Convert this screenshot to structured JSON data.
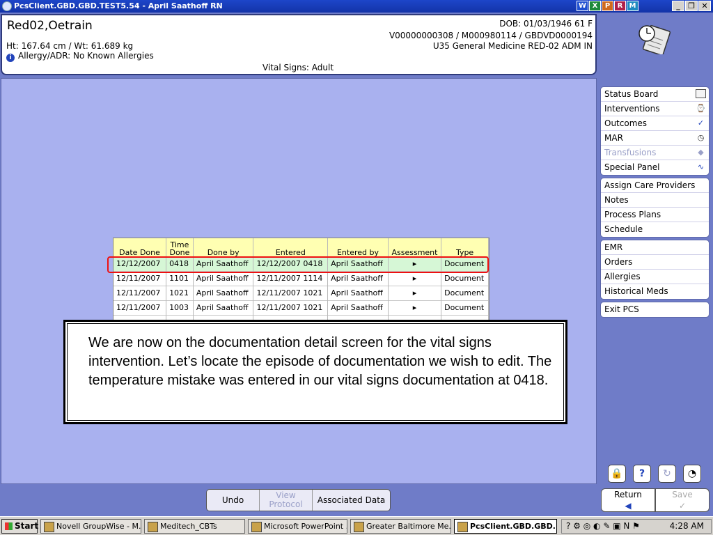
{
  "window": {
    "title": "PcsClient.GBD.GBD.TEST5.54 - April Saathoff RN",
    "app_buttons": [
      "W",
      "X",
      "P",
      "R",
      "M"
    ]
  },
  "patient": {
    "name": "Red02,Oetrain",
    "ht_wt": "Ht: 167.64 cm / Wt: 61.689 kg",
    "allergy": "Allergy/ADR: No Known Allergies",
    "dob": "DOB: 01/03/1946 61 F",
    "account": "V00000000308 / M000980114 / GBDVD0000194",
    "location": "U35 General Medicine  RED-02  ADM IN",
    "screen_title": "Vital Signs: Adult"
  },
  "grid": {
    "columns": [
      "Date Done",
      "Time Done",
      "Done by",
      "Entered",
      "Entered by",
      "Assessment",
      "Type"
    ],
    "rows": [
      [
        "12/12/2007",
        "0418",
        "April Saathoff",
        "12/12/2007 0418",
        "April Saathoff",
        "▸",
        "Document"
      ],
      [
        "12/11/2007",
        "1101",
        "April Saathoff",
        "12/11/2007 1114",
        "April Saathoff",
        "▸",
        "Document"
      ],
      [
        "12/11/2007",
        "1021",
        "April Saathoff",
        "12/11/2007 1021",
        "April Saathoff",
        "▸",
        "Document"
      ],
      [
        "12/11/2007",
        "1003",
        "April Saathoff",
        "12/11/2007 1021",
        "April Saathoff",
        "▸",
        "Document"
      ],
      [
        "",
        "",
        "",
        "",
        "",
        "",
        ""
      ]
    ]
  },
  "callout": {
    "text": "We are now on the documentation detail screen for the vital signs intervention. Let’s locate the episode of documentation we wish to edit. The temperature mistake was entered in our vital signs documentation at 0418."
  },
  "actions": {
    "undo": "Undo",
    "view_protocol": "View Protocol",
    "associated_data": "Associated Data"
  },
  "menu": {
    "group1": [
      {
        "label": "Status Board",
        "icon": "book-icon"
      },
      {
        "label": "Interventions",
        "icon": "interventions-icon"
      },
      {
        "label": "Outcomes",
        "icon": "outcomes-icon"
      },
      {
        "label": "MAR",
        "icon": "mar-icon"
      },
      {
        "label": "Transfusions",
        "icon": "transfusions-icon"
      },
      {
        "label": "Special Panel",
        "icon": "heartbeat-icon"
      }
    ],
    "group2": [
      "Assign Care Providers",
      "Notes",
      "Process Plans",
      "Schedule"
    ],
    "group3": [
      "EMR",
      "Orders",
      "Allergies",
      "Historical Meds"
    ],
    "group4": [
      "Exit PCS"
    ]
  },
  "bottom_buttons": {
    "return_label": "Return",
    "save_label": "Save"
  },
  "taskbar": {
    "start": "Start",
    "tasks": [
      "Novell GroupWise - M...",
      "Meditech_CBTs",
      "Microsoft PowerPoint ...",
      "Greater Baltimore Me...",
      "PcsClient.GBD.GBD...."
    ],
    "time": "4:28 AM"
  },
  "colors": {
    "background": "#6f7cc8",
    "panel": "#a9b1ef",
    "header_row": "#ffffb2",
    "selected_row": "#d6f7d6",
    "highlight": "#e11111"
  }
}
